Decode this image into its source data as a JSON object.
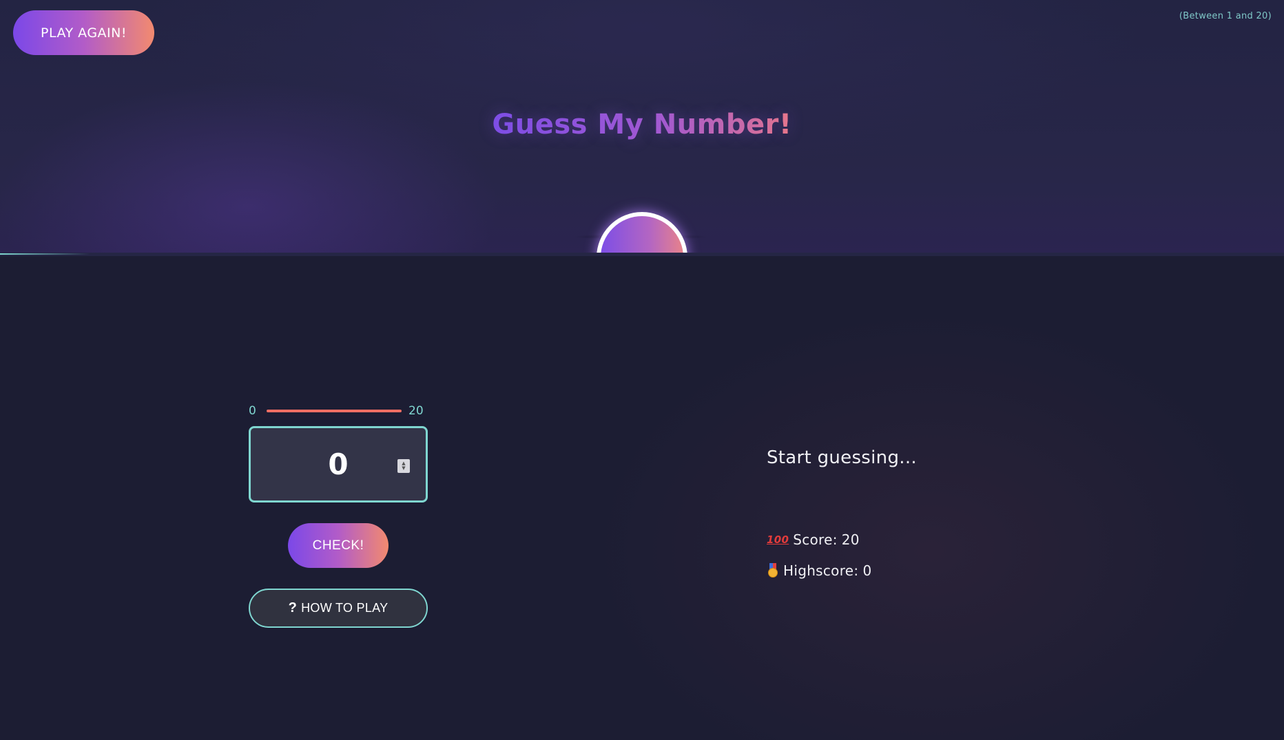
{
  "header": {
    "play_again_label": "PLAY AGAIN!",
    "range_hint": "(Between 1 and 20)",
    "title": "Guess My Number!"
  },
  "guess": {
    "slider_min": "0",
    "slider_max": "20",
    "value": "0"
  },
  "actions": {
    "check_label": "CHECK!",
    "how_to_play_icon": "?",
    "how_to_play_label": "HOW TO PLAY"
  },
  "status": {
    "message": "Start guessing...",
    "score_icon": "100",
    "score_label": "Score:",
    "score_value": "20",
    "highscore_label": "Highscore:",
    "highscore_value": "0"
  },
  "colors": {
    "accent_teal": "#7fd6d0",
    "gradient_start": "#7b48e8",
    "gradient_end": "#f28a6f",
    "slider_track": "#ee6e63",
    "background": "#1c1d33"
  },
  "icons": {
    "score": "hundred-points-icon",
    "highscore": "medal-icon",
    "help": "question-icon"
  }
}
